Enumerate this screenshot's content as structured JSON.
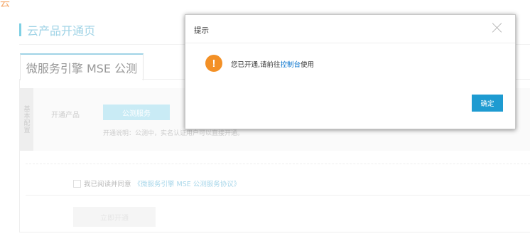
{
  "brand": {
    "logo_text": "云"
  },
  "header": {
    "title": "云产品开通页"
  },
  "tabs": [
    {
      "label": "微服务引擎 MSE 公测"
    }
  ],
  "form": {
    "section_label": "基本配置",
    "product_label": "开通产品",
    "service_button": "公测服务",
    "description": "开通说明：公测中，实名认证用户可以直接开通。"
  },
  "agreement": {
    "text": "我已阅读并同意",
    "link": "《微服务引擎 MSE 公测服务协议》"
  },
  "actions": {
    "open_now": "立即开通"
  },
  "dialog": {
    "title": "提示",
    "icon": "!",
    "message_prefix": "您已开通,请前往",
    "message_link": "控制台",
    "message_suffix": "使用",
    "confirm": "确定"
  }
}
